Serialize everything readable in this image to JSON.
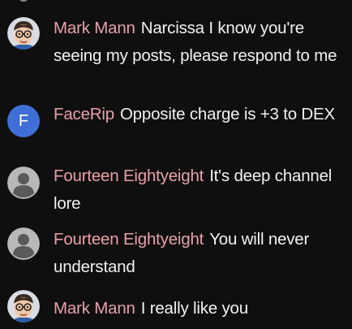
{
  "colors": {
    "background": "#0f0f0f",
    "author": "#e8a0a8",
    "message": "#f1f1f1",
    "letter_avatar": "#3f6fd6",
    "default_avatar": "#b8b8b8"
  },
  "messages": [
    {
      "author": "Mark Mann",
      "text": "Narcissa I know you're seeing my posts, please respond to me",
      "avatar": "cartoon-face-glasses-icon"
    },
    {
      "author": "FaceRip",
      "text": "Opposite charge is +3 to DEX",
      "avatar_letter": "F"
    },
    {
      "author": "Fourteen Eightyeight",
      "text": "It's deep channel lore",
      "avatar": "default-person-icon"
    },
    {
      "author": "Fourteen Eightyeight",
      "text": "You will never understand",
      "avatar": "default-person-icon"
    },
    {
      "author": "Mark Mann",
      "text": "I really like you",
      "avatar": "cartoon-face-glasses-icon"
    }
  ]
}
